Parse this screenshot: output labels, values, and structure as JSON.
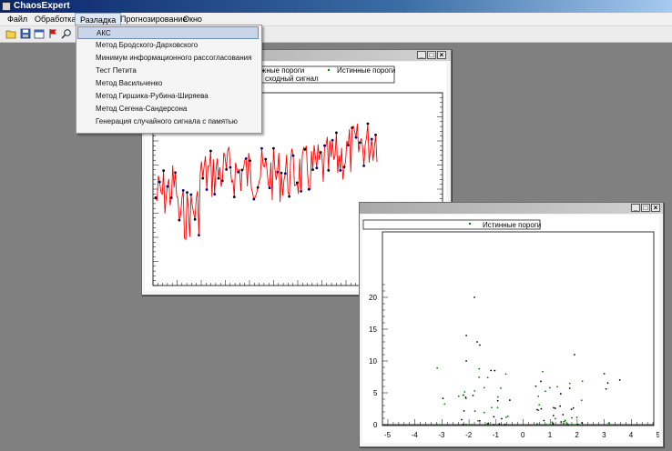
{
  "app": {
    "title": "ChaosExpert"
  },
  "menu": [
    {
      "label": "Файл"
    },
    {
      "label": "Обработка"
    },
    {
      "label": "Разладка"
    },
    {
      "label": "Прогнозирование"
    },
    {
      "label": "Окно"
    }
  ],
  "toolbar": [
    "open-folder-icon",
    "save-icon",
    "window-icon",
    "flag-icon",
    "magnifier-icon"
  ],
  "dropdown": [
    {
      "label": "АКС",
      "selected": true
    },
    {
      "label": "Метод Бродского-Дарховского"
    },
    {
      "label": "Минимум информационного рассогласования"
    },
    {
      "label": "Тест Петита"
    },
    {
      "label": "Метод Васильченко"
    },
    {
      "label": "Метод Гиршика-Рубина-Ширяева"
    },
    {
      "label": "Метод Сегена-Сандерсона"
    },
    {
      "label": "Генерация случайного сигнала с памятью"
    }
  ],
  "window1": {
    "legend": {
      "false": "жные пороги",
      "true": "Истинные пороги",
      "signal": "сходный сигнал"
    }
  },
  "window2": {
    "legend": {
      "true": "Истинные пороги"
    },
    "x_ticks": [
      "-5",
      "-4",
      "-3",
      "-2",
      "-1",
      "0",
      "1",
      "2",
      "3",
      "4",
      "5"
    ],
    "y_ticks": [
      "0",
      "5",
      "10",
      "15",
      "20"
    ]
  },
  "colors": {
    "signal": "#ff0000",
    "true_thresholds": "#008000",
    "false_thresholds": "#000080"
  }
}
